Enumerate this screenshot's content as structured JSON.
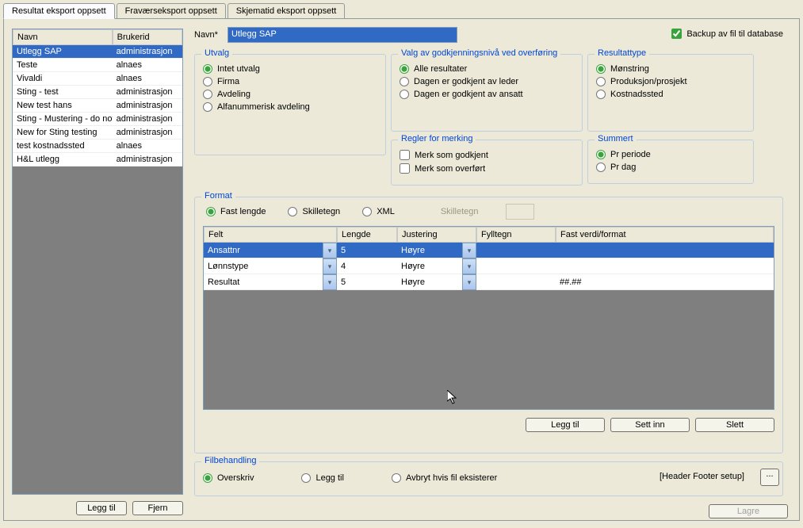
{
  "tabs": [
    "Resultat eksport oppsett",
    "Fraværseksport oppsett",
    "Skjematid eksport oppsett"
  ],
  "left": {
    "headers": [
      "Navn",
      "Brukerid"
    ],
    "rows": [
      {
        "navn": "Utlegg SAP",
        "brukerid": "administrasjon",
        "selected": true
      },
      {
        "navn": "Teste",
        "brukerid": "alnaes"
      },
      {
        "navn": "Vivaldi",
        "brukerid": "alnaes"
      },
      {
        "navn": "Sting - test",
        "brukerid": "administrasjon"
      },
      {
        "navn": "New test hans",
        "brukerid": "administrasjon"
      },
      {
        "navn": "Sting - Mustering - do not c",
        "brukerid": "administrasjon"
      },
      {
        "navn": "New for Sting testing",
        "brukerid": "administrasjon"
      },
      {
        "navn": "test kostnadssted",
        "brukerid": "alnaes"
      },
      {
        "navn": "H&L utlegg",
        "brukerid": "administrasjon"
      }
    ],
    "buttons": {
      "add": "Legg til",
      "remove": "Fjern"
    }
  },
  "form": {
    "navn_label": "Navn*",
    "navn_value": "Utlegg SAP",
    "backup_label": "Backup av fil til database",
    "backup_checked": true,
    "utvalg": {
      "legend": "Utvalg",
      "options": [
        "Intet utvalg",
        "Firma",
        "Avdeling",
        "Alfanummerisk avdeling"
      ],
      "selected": 0
    },
    "valg": {
      "legend": "Valg av godkjenningsnivå ved overføring",
      "options": [
        "Alle resultater",
        "Dagen er godkjent av leder",
        "Dagen er godkjent av ansatt"
      ],
      "selected": 0
    },
    "regler": {
      "legend": "Regler for merking",
      "checks": [
        {
          "label": "Merk som godkjent",
          "checked": false
        },
        {
          "label": "Merk som overført",
          "checked": false
        }
      ]
    },
    "resultattype": {
      "legend": "Resultattype",
      "options": [
        "Mønstring",
        "Produksjon/prosjekt",
        "Kostnadssted"
      ],
      "selected": 0
    },
    "summert": {
      "legend": "Summert",
      "options": [
        "Pr periode",
        "Pr dag"
      ],
      "selected": 0
    },
    "format": {
      "legend": "Format",
      "type_options": [
        "Fast lengde",
        "Skilletegn",
        "XML"
      ],
      "type_selected": 0,
      "skilletegn_label": "Skilletegn",
      "headers": [
        "Felt",
        "Lengde",
        "Justering",
        "Fylltegn",
        "Fast verdi/format"
      ],
      "rows": [
        {
          "felt": "Ansattnr",
          "lengde": "5",
          "justering": "Høyre",
          "fylltegn": "",
          "fast": "",
          "selected": true
        },
        {
          "felt": "Lønnstype",
          "lengde": "4",
          "justering": "Høyre",
          "fylltegn": "",
          "fast": ""
        },
        {
          "felt": "Resultat",
          "lengde": "5",
          "justering": "Høyre",
          "fylltegn": "",
          "fast": "##.##"
        }
      ],
      "buttons": {
        "add": "Legg til",
        "insert": "Sett inn",
        "delete": "Slett"
      }
    },
    "filbehandling": {
      "legend": "Filbehandling",
      "options": [
        "Overskriv",
        "Legg til",
        "Avbryt hvis fil eksisterer"
      ],
      "selected": 0,
      "header_footer": "[Header Footer setup]",
      "ellipsis": "..."
    },
    "save": "Lagre"
  }
}
